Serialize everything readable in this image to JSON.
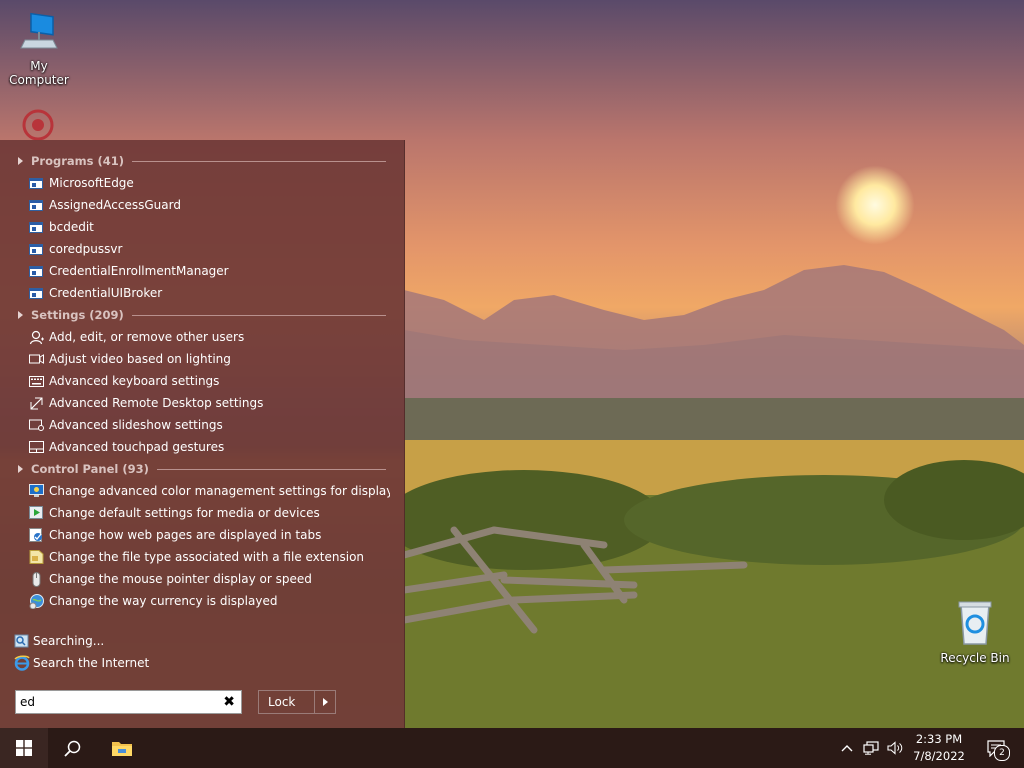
{
  "desktop": {
    "my_computer": "My Computer",
    "recycle_bin": "Recycle Bin"
  },
  "start_menu": {
    "groups": [
      {
        "label": "Programs (41)"
      },
      {
        "label": "Settings (209)"
      },
      {
        "label": "Control Panel (93)"
      }
    ],
    "programs": [
      "MicrosoftEdge",
      "AssignedAccessGuard",
      "bcdedit",
      "coredpussvr",
      "CredentialEnrollmentManager",
      "CredentialUIBroker"
    ],
    "settings": [
      "Add, edit, or remove other users",
      "Adjust video based on lighting",
      "Advanced keyboard settings",
      "Advanced Remote Desktop settings",
      "Advanced slideshow settings",
      "Advanced touchpad gestures"
    ],
    "control_panel": [
      "Change advanced color management settings for displays, sca...",
      "Change default settings for media or devices",
      "Change how web pages are displayed in tabs",
      "Change the file type associated with a file extension",
      "Change the mouse pointer display or speed",
      "Change the way currency is displayed"
    ],
    "searching": "Searching...",
    "search_internet": "Search the Internet",
    "search_value": "ed",
    "lock_label": "Lock"
  },
  "taskbar": {
    "time": "2:33 PM",
    "date": "7/8/2022",
    "notification_count": "2"
  }
}
